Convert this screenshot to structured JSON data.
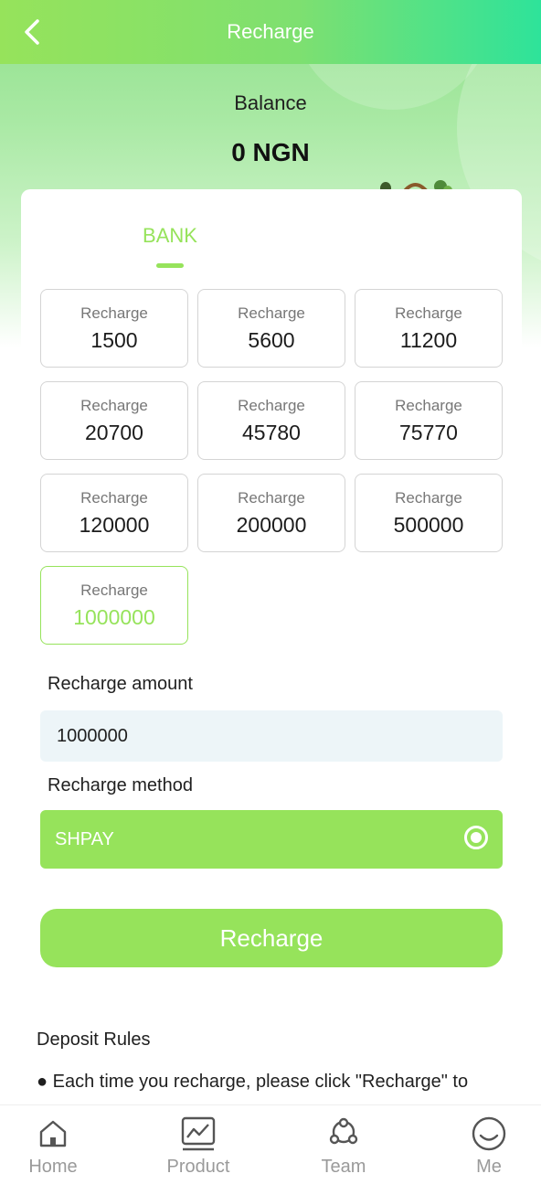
{
  "header": {
    "title": "Recharge",
    "back_icon": "chevron-left-icon"
  },
  "balance": {
    "label": "Balance",
    "value": "0 NGN"
  },
  "tabs": [
    {
      "label": "BANK",
      "active": true
    }
  ],
  "amount_options": [
    {
      "label": "Recharge",
      "value": "1500",
      "selected": false
    },
    {
      "label": "Recharge",
      "value": "5600",
      "selected": false
    },
    {
      "label": "Recharge",
      "value": "11200",
      "selected": false
    },
    {
      "label": "Recharge",
      "value": "20700",
      "selected": false
    },
    {
      "label": "Recharge",
      "value": "45780",
      "selected": false
    },
    {
      "label": "Recharge",
      "value": "75770",
      "selected": false
    },
    {
      "label": "Recharge",
      "value": "120000",
      "selected": false
    },
    {
      "label": "Recharge",
      "value": "200000",
      "selected": false
    },
    {
      "label": "Recharge",
      "value": "500000",
      "selected": false
    },
    {
      "label": "Recharge",
      "value": "1000000",
      "selected": true
    }
  ],
  "form": {
    "amount_label": "Recharge amount",
    "amount_value": "1000000",
    "method_label": "Recharge method",
    "method_value": "SHPAY",
    "submit_label": "Recharge"
  },
  "rules": {
    "title": "Deposit Rules",
    "text": "● Each time you recharge, please click \"Recharge\" to"
  },
  "nav": [
    {
      "label": "Home",
      "icon": "home-icon"
    },
    {
      "label": "Product",
      "icon": "chart-icon"
    },
    {
      "label": "Team",
      "icon": "team-icon"
    },
    {
      "label": "Me",
      "icon": "profile-icon"
    }
  ],
  "colors": {
    "accent": "#96e35b",
    "header_end": "#2ee39a",
    "input_bg": "#edf5f8",
    "nav_text": "#9a9a9a"
  }
}
